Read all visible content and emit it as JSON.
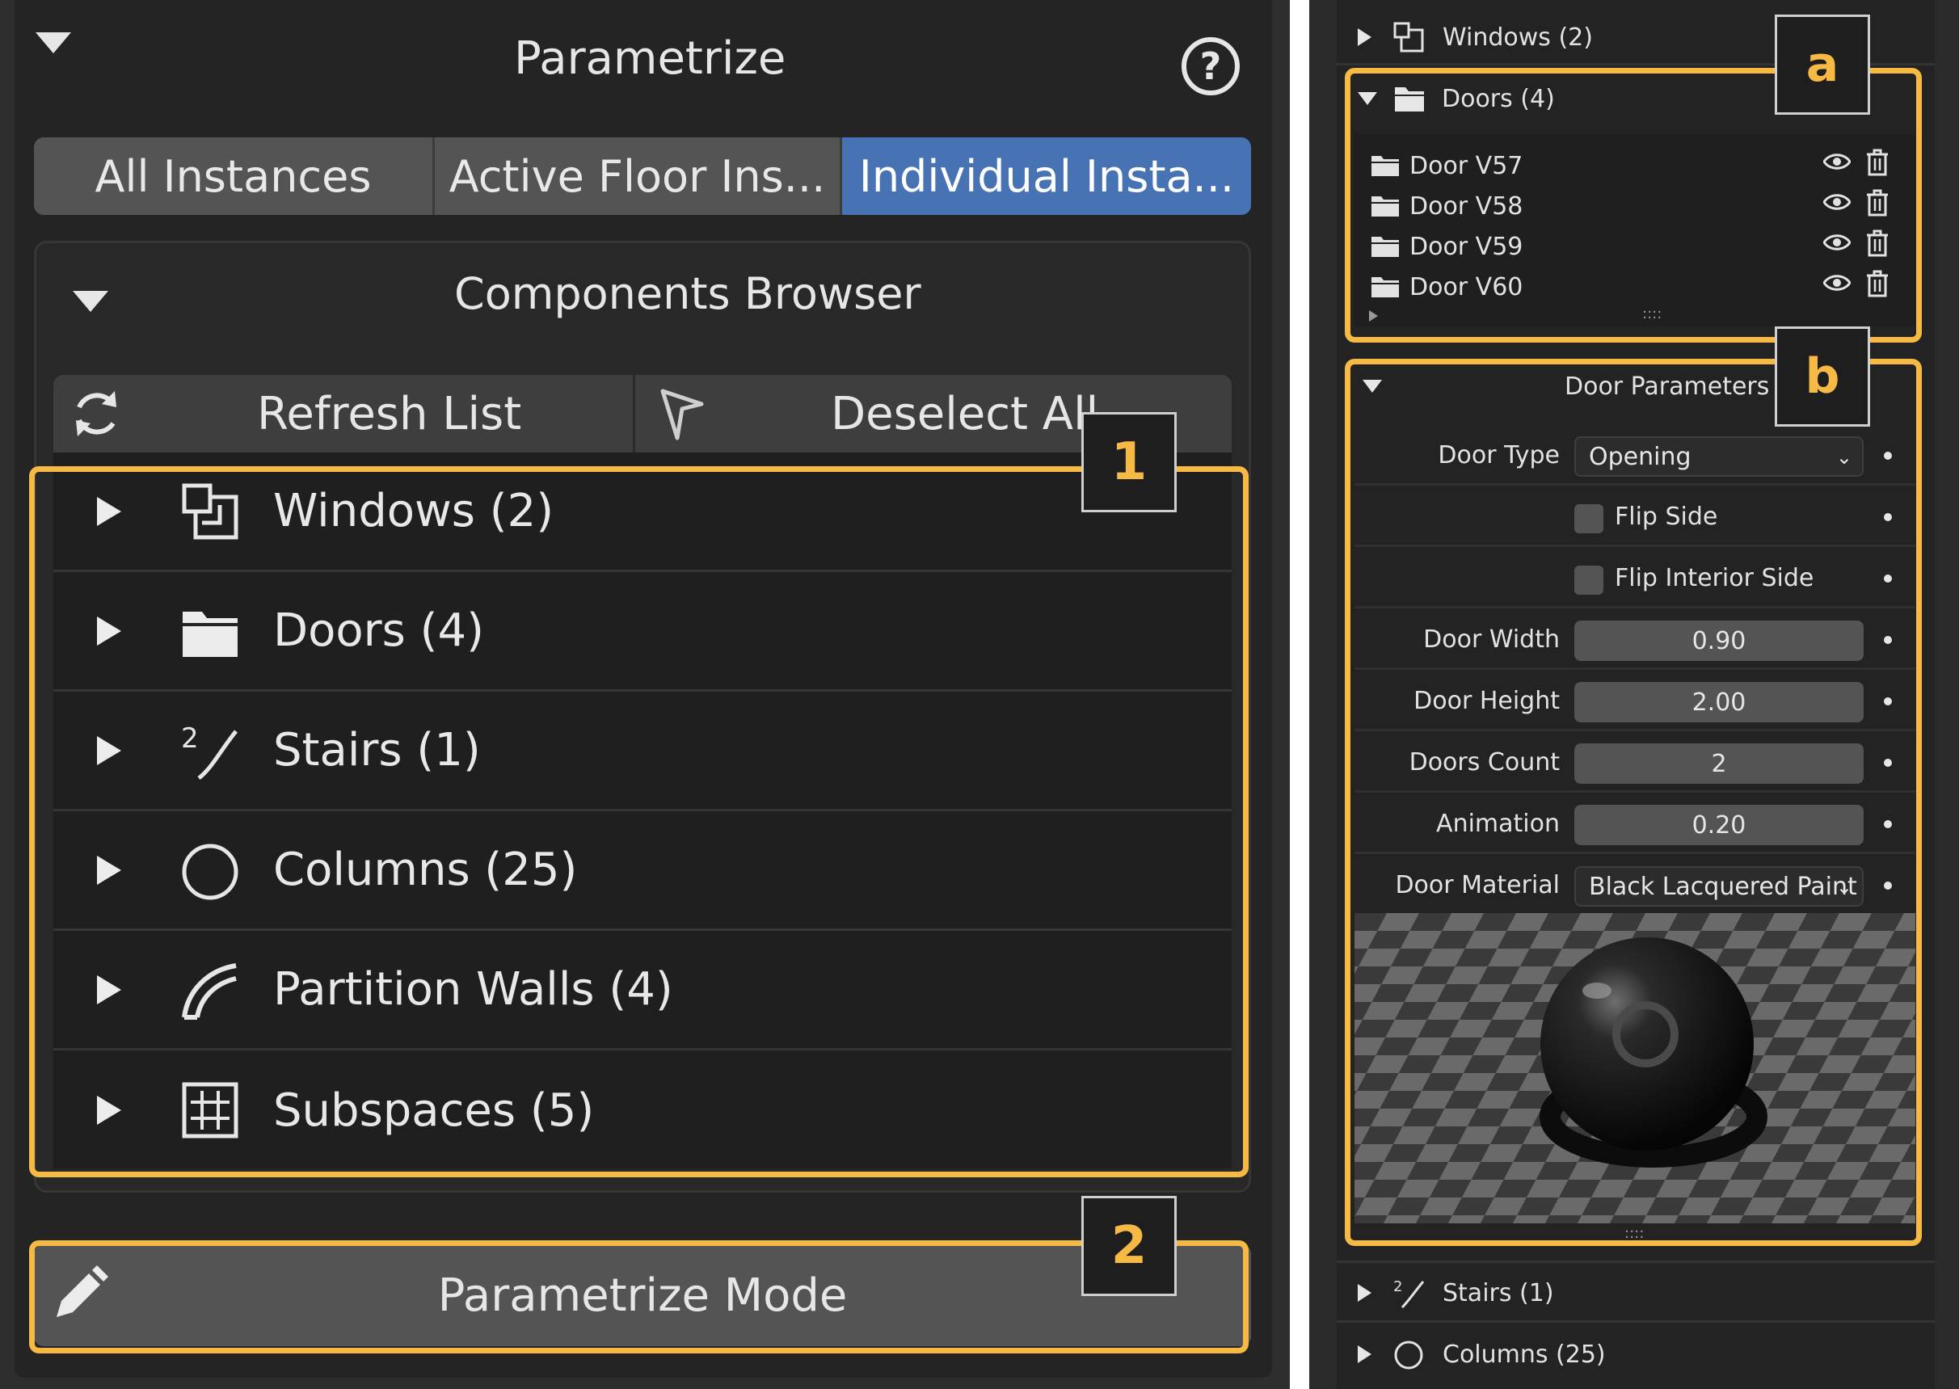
{
  "left_panel": {
    "title": "Parametrize",
    "help_icon": "?",
    "tabs": [
      {
        "label": "All Instances",
        "active": false
      },
      {
        "label": "Active Floor Ins...",
        "active": false
      },
      {
        "label": "Individual Insta...",
        "active": true
      }
    ],
    "browser": {
      "title": "Components Browser",
      "refresh_label": "Refresh List",
      "deselect_label": "Deselect All",
      "categories": [
        {
          "label": "Windows (2)",
          "icon": "window-icon"
        },
        {
          "label": "Doors (4)",
          "icon": "folder-icon"
        },
        {
          "label": "Stairs (1)",
          "icon": "stairs-icon"
        },
        {
          "label": "Columns (25)",
          "icon": "circle-icon"
        },
        {
          "label": "Partition Walls (4)",
          "icon": "arc-icon"
        },
        {
          "label": "Subspaces (5)",
          "icon": "grid-icon"
        }
      ]
    },
    "parametrize_mode_label": "Parametrize Mode",
    "badges": {
      "one": "1",
      "two": "2"
    }
  },
  "right_panel": {
    "windows_label": "Windows (2)",
    "doors_label": "Doors (4)",
    "doors": [
      {
        "label": "Door V57"
      },
      {
        "label": "Door V58"
      },
      {
        "label": "Door V59"
      },
      {
        "label": "Door V60"
      }
    ],
    "list_grip": "::::",
    "door_params_title": "Door Parameters",
    "params": {
      "door_type_label": "Door Type",
      "door_type_value": "Opening",
      "flip_side_label": "Flip Side",
      "flip_interior_label": "Flip Interior Side",
      "door_width_label": "Door Width",
      "door_width_value": "0.90",
      "door_height_label": "Door Height",
      "door_height_value": "2.00",
      "doors_count_label": "Doors Count",
      "doors_count_value": "2",
      "animation_label": "Animation",
      "animation_value": "0.20",
      "door_material_label": "Door Material",
      "door_material_value": "Black Lacquered Paint"
    },
    "stairs_label": "Stairs (1)",
    "columns_label": "Columns (25)",
    "badges": {
      "a": "a",
      "b": "b"
    }
  },
  "colors": {
    "highlight": "#f5b944",
    "active_tab": "#4772b3",
    "panel_bg": "#242424"
  }
}
